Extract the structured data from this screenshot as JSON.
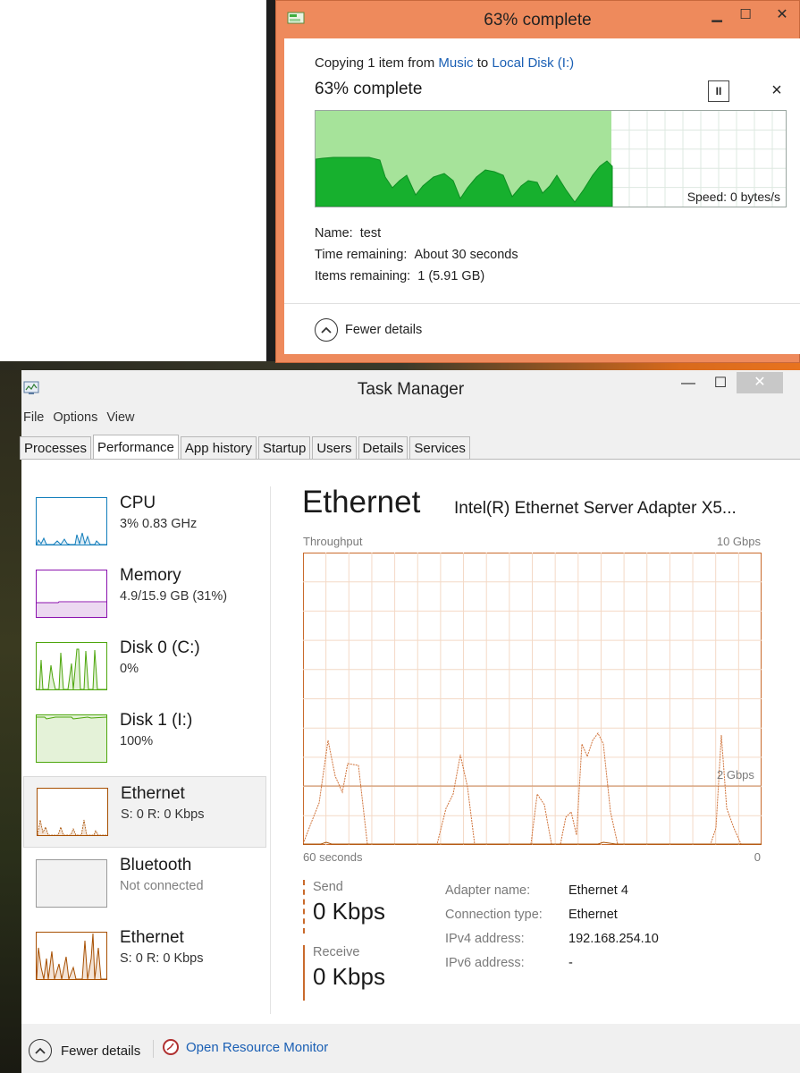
{
  "copy_dialog": {
    "title": "63% complete",
    "copy_prefix": "Copying 1 item from ",
    "source_link": "Music",
    "to_word": " to ",
    "dest_link": "Local Disk (I:)",
    "heading": "63% complete",
    "progress_fraction": 0.63,
    "speed_text": "Speed: 0 bytes/s",
    "details": [
      {
        "label": "Name:",
        "value": "test"
      },
      {
        "label": "Time remaining:",
        "value": "About 30 seconds"
      },
      {
        "label": "Items remaining:",
        "value": "1 (5.91 GB)"
      }
    ],
    "fewer_details": "Fewer details",
    "pause_glyph": "II",
    "cancel_glyph": "×",
    "controls": {
      "minimize": "▁",
      "maximize": "☐",
      "close": "✕"
    }
  },
  "task_manager": {
    "title": "Task Manager",
    "controls": {
      "minimize": "—",
      "maximize": "☐",
      "close": "✕"
    },
    "menu": [
      "File",
      "Options",
      "View"
    ],
    "tabs": [
      "Processes",
      "Performance",
      "App history",
      "Startup",
      "Users",
      "Details",
      "Services"
    ],
    "active_tab": "Performance",
    "sidebar": [
      {
        "name": "CPU",
        "sub": "3%  0.83 GHz",
        "color": "#117dbb",
        "kind": "cpu"
      },
      {
        "name": "Memory",
        "sub": "4.9/15.9 GB (31%)",
        "color": "#8b12ae",
        "kind": "memory"
      },
      {
        "name": "Disk 0 (C:)",
        "sub": "0%",
        "color": "#4da60c",
        "kind": "disk0"
      },
      {
        "name": "Disk 1 (I:)",
        "sub": "100%",
        "color": "#4da60c",
        "kind": "disk1"
      },
      {
        "name": "Ethernet",
        "sub": "S: 0  R: 0 Kbps",
        "color": "#a74f01",
        "kind": "eth1"
      },
      {
        "name": "Bluetooth",
        "sub": "Not connected",
        "color": "#9a9a9a",
        "kind": "bt"
      },
      {
        "name": "Ethernet",
        "sub": "S: 0  R: 0 Kbps",
        "color": "#a74f01",
        "kind": "eth2"
      }
    ],
    "main": {
      "title": "Ethernet",
      "adapter": "Intel(R) Ethernet Server Adapter X5...",
      "throughput_label": "Throughput",
      "max_scale": "10 Gbps",
      "ref_label": "2 Gbps",
      "time_label": "60 seconds",
      "zero_label": "0",
      "send_label": "Send",
      "send_value": "0 Kbps",
      "receive_label": "Receive",
      "receive_value": "0 Kbps",
      "properties": [
        {
          "key": "Adapter name:",
          "value": "Ethernet 4"
        },
        {
          "key": "Connection type:",
          "value": "Ethernet"
        },
        {
          "key": "IPv4 address:",
          "value": "192.168.254.10"
        },
        {
          "key": "IPv6 address:",
          "value": "-"
        }
      ]
    },
    "footer": {
      "fewer_details": "Fewer details",
      "resource_monitor": "Open Resource Monitor"
    },
    "accent_color": "#c96a2c"
  }
}
